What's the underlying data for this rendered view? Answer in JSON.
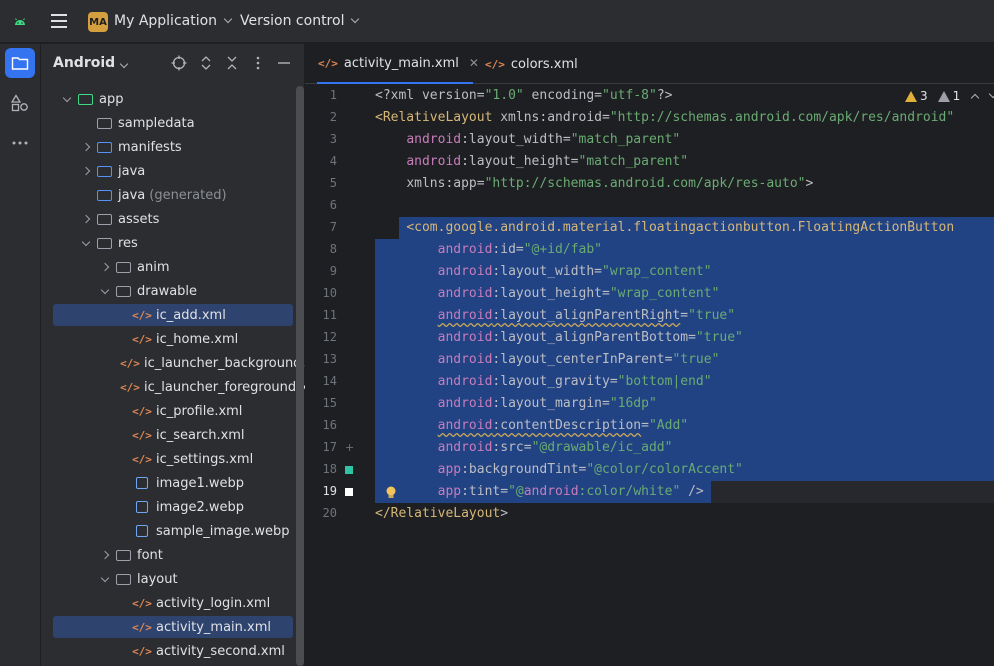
{
  "topbar": {
    "project_badge": "MA",
    "project_name": "My Application",
    "version_control": "Version control"
  },
  "panel": {
    "title": "Android",
    "tree": [
      {
        "label": "app",
        "depth": 0,
        "expand": "down",
        "icon": "module-folder"
      },
      {
        "label": "sampledata",
        "depth": 1,
        "expand": "none",
        "icon": "folder"
      },
      {
        "label": "manifests",
        "depth": 1,
        "expand": "right",
        "icon": "blue-folder"
      },
      {
        "label": "java",
        "depth": 1,
        "expand": "right",
        "icon": "blue-folder"
      },
      {
        "label": "java",
        "suffix": "(generated)",
        "depth": 1,
        "expand": "none",
        "icon": "blue-folder"
      },
      {
        "label": "assets",
        "depth": 1,
        "expand": "right",
        "icon": "res-folder"
      },
      {
        "label": "res",
        "depth": 1,
        "expand": "down",
        "icon": "res-folder"
      },
      {
        "label": "anim",
        "depth": 2,
        "expand": "right",
        "icon": "folder"
      },
      {
        "label": "drawable",
        "depth": 2,
        "expand": "down",
        "icon": "folder"
      },
      {
        "label": "ic_add.xml",
        "depth": 3,
        "expand": "none",
        "icon": "xml",
        "selected": true
      },
      {
        "label": "ic_home.xml",
        "depth": 3,
        "expand": "none",
        "icon": "xml"
      },
      {
        "label": "ic_launcher_background.xml",
        "depth": 3,
        "expand": "none",
        "icon": "xml"
      },
      {
        "label": "ic_launcher_foreground.xml",
        "depth": 3,
        "expand": "none",
        "icon": "xml"
      },
      {
        "label": "ic_profile.xml",
        "depth": 3,
        "expand": "none",
        "icon": "xml"
      },
      {
        "label": "ic_search.xml",
        "depth": 3,
        "expand": "none",
        "icon": "xml"
      },
      {
        "label": "ic_settings.xml",
        "depth": 3,
        "expand": "none",
        "icon": "xml"
      },
      {
        "label": "image1.webp",
        "depth": 3,
        "expand": "none",
        "icon": "image"
      },
      {
        "label": "image2.webp",
        "depth": 3,
        "expand": "none",
        "icon": "image"
      },
      {
        "label": "sample_image.webp",
        "depth": 3,
        "expand": "none",
        "icon": "image"
      },
      {
        "label": "font",
        "depth": 2,
        "expand": "right",
        "icon": "folder"
      },
      {
        "label": "layout",
        "depth": 2,
        "expand": "down",
        "icon": "folder"
      },
      {
        "label": "activity_login.xml",
        "depth": 3,
        "expand": "none",
        "icon": "xml"
      },
      {
        "label": "activity_main.xml",
        "depth": 3,
        "expand": "none",
        "icon": "xml",
        "selected": true
      },
      {
        "label": "activity_second.xml",
        "depth": 3,
        "expand": "none",
        "icon": "xml"
      }
    ]
  },
  "editor": {
    "tabs": [
      {
        "label": "activity_main.xml",
        "active": true
      },
      {
        "label": "colors.xml",
        "active": false
      }
    ],
    "warnings": "3",
    "weak_warnings": "1",
    "current_line": 19,
    "lines": [
      "<?xml version=\"1.0\" encoding=\"utf-8\"?>",
      "<RelativeLayout xmlns:android=\"http://schemas.android.com/apk/res/android\"",
      "    android:layout_width=\"match_parent\"",
      "    android:layout_height=\"match_parent\"",
      "    xmlns:app=\"http://schemas.android.com/apk/res-auto\">",
      "",
      "    <com.google.android.material.floatingactionbutton.FloatingActionButton",
      "        android:id=\"@+id/fab\"",
      "        android:layout_width=\"wrap_content\"",
      "        android:layout_height=\"wrap_content\"",
      "        android:layout_alignParentRight=\"true\"",
      "        android:layout_alignParentBottom=\"true\"",
      "        android:layout_centerInParent=\"true\"",
      "        android:layout_gravity=\"bottom|end\"",
      "        android:layout_margin=\"16dp\"",
      "        android:contentDescription=\"Add\"",
      "        android:src=\"@drawable/ic_add\"",
      "        app:backgroundTint=\"@color/colorAccent\"",
      "        app:tint=\"@android:color/white\" />",
      "</RelativeLayout>"
    ],
    "gutter_colors": {
      "line18": "#2fc4a4",
      "line19": "#ffffff"
    }
  }
}
